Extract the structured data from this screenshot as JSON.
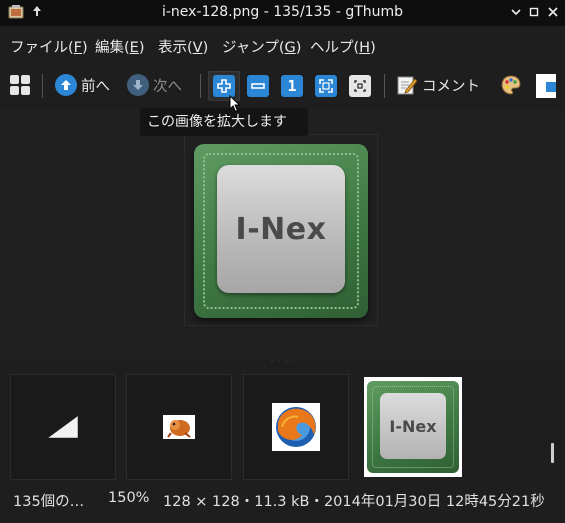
{
  "window": {
    "title": "i-nex-128.png - 135/135 - gThumb",
    "controls": {
      "minimize": "⌄",
      "maximize": "□",
      "close": "✕"
    }
  },
  "menubar": {
    "items": [
      {
        "label": "ファイル(",
        "key": "F",
        "end": ")"
      },
      {
        "label": "編集(",
        "key": "E",
        "end": ")"
      },
      {
        "label": "表示(",
        "key": "V",
        "end": ")"
      },
      {
        "label": "ジャンプ(",
        "key": "G",
        "end": ")"
      },
      {
        "label": "ヘルプ(",
        "key": "H",
        "end": ")"
      }
    ]
  },
  "toolbar": {
    "prev_label": "前へ",
    "next_label": "次へ",
    "comment_label": "コメント",
    "one_to_one_label": "1"
  },
  "tooltip": {
    "text": "この画像を拡大します"
  },
  "viewer": {
    "image_text": "I-Nex"
  },
  "thumbnails": {
    "selected_text": "I-Nex"
  },
  "statusbar": {
    "count": "135個の…",
    "zoom": "150%",
    "info": "128 × 128・11.3 kB・2014年01月30日 12時45分21秒"
  },
  "colors": {
    "accent": "#2b86d6",
    "background": "#1e1e1e",
    "chip_green": "#4f8a53"
  }
}
